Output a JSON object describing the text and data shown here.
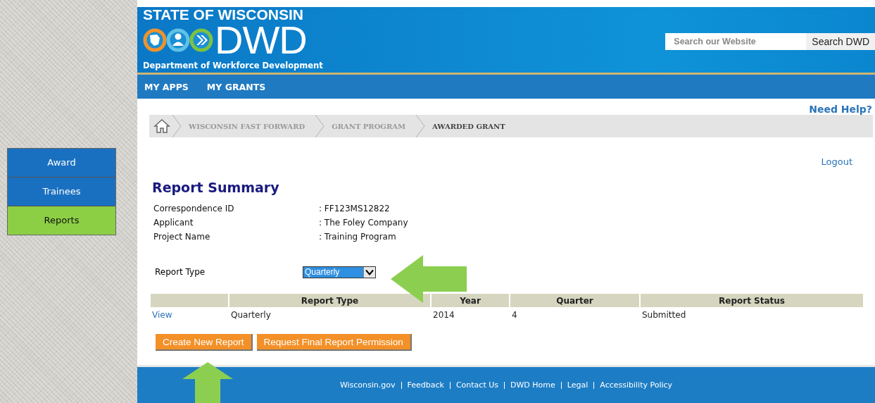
{
  "header": {
    "state_line": "STATE OF WISCONSIN",
    "logo_text": "DWD",
    "department": "Department of Workforce Development",
    "search": {
      "placeholder": "Search our Website",
      "button": "Search DWD"
    }
  },
  "nav": [
    "MY APPS",
    "MY GRANTS"
  ],
  "help_link": "Need Help?",
  "breadcrumb": [
    {
      "label": "WISCONSIN FAST FORWARD",
      "current": false
    },
    {
      "label": "GRANT PROGRAM",
      "current": false
    },
    {
      "label": "AWARDED GRANT",
      "current": true
    }
  ],
  "sidebar": [
    {
      "label": "Award",
      "selected": false
    },
    {
      "label": "Trainees",
      "selected": false
    },
    {
      "label": "Reports",
      "selected": true
    }
  ],
  "logout": "Logout",
  "title": "Report Summary",
  "details": [
    {
      "label": "Correspondence ID",
      "value": ": FF123MS12822"
    },
    {
      "label": "Applicant",
      "value": ": The Foley Company"
    },
    {
      "label": "Project Name",
      "value": ": Training Program"
    }
  ],
  "report_type": {
    "label": "Report Type",
    "value": "Quarterly"
  },
  "table": {
    "columns": [
      "Report Type",
      "Year",
      "Quarter",
      "Report Status"
    ],
    "rows": [
      {
        "link": "View",
        "cells": [
          "Quarterly",
          "2014",
          "4",
          "Submitted"
        ]
      }
    ]
  },
  "buttons": [
    "Create New Report",
    "Request Final Report Permission"
  ],
  "footer_links": [
    "Wisconsin.gov",
    "Feedback",
    "Contact Us",
    "DWD Home",
    "Legal",
    "Accessibility Policy"
  ]
}
